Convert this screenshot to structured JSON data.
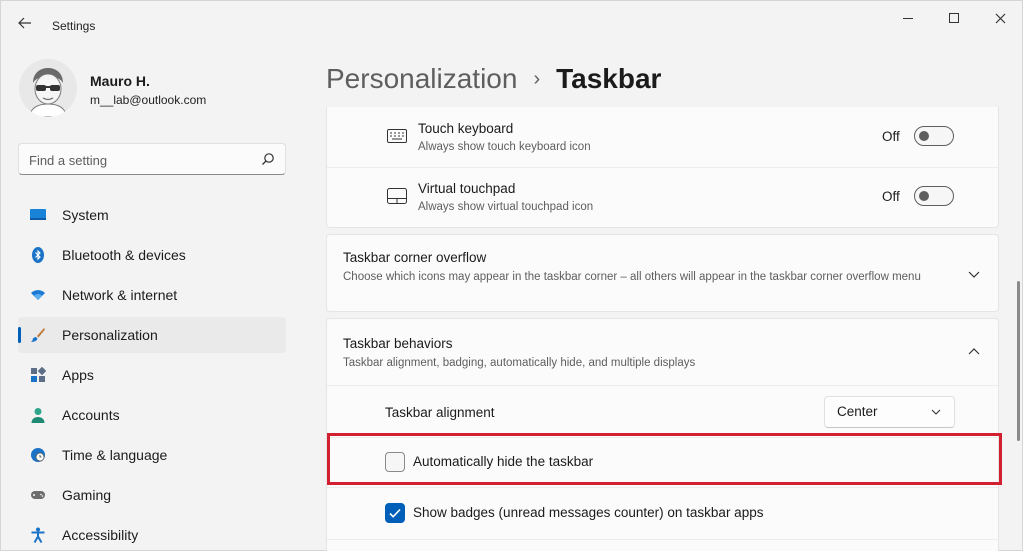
{
  "app": {
    "title": "Settings"
  },
  "profile": {
    "name": "Mauro H.",
    "email": "m__lab@outlook.com"
  },
  "search": {
    "placeholder": "Find a setting"
  },
  "sidebar": {
    "items": [
      {
        "label": "System",
        "icon": "monitor-icon",
        "selected": false
      },
      {
        "label": "Bluetooth & devices",
        "icon": "bluetooth-icon",
        "selected": false
      },
      {
        "label": "Network & internet",
        "icon": "wifi-icon",
        "selected": false
      },
      {
        "label": "Personalization",
        "icon": "paintbrush-icon",
        "selected": true
      },
      {
        "label": "Apps",
        "icon": "apps-icon",
        "selected": false
      },
      {
        "label": "Accounts",
        "icon": "person-icon",
        "selected": false
      },
      {
        "label": "Time & language",
        "icon": "globe-clock-icon",
        "selected": false
      },
      {
        "label": "Gaming",
        "icon": "gamepad-icon",
        "selected": false
      },
      {
        "label": "Accessibility",
        "icon": "accessibility-icon",
        "selected": false
      }
    ]
  },
  "breadcrumb": {
    "parent": "Personalization",
    "separator": "›",
    "current": "Taskbar"
  },
  "main": {
    "touch_keyboard": {
      "title": "Touch keyboard",
      "subtitle": "Always show touch keyboard icon",
      "state": "Off"
    },
    "virtual_touchpad": {
      "title": "Virtual touchpad",
      "subtitle": "Always show virtual touchpad icon",
      "state": "Off"
    },
    "corner_overflow": {
      "title": "Taskbar corner overflow",
      "subtitle": "Choose which icons may appear in the taskbar corner – all others will appear in the taskbar corner overflow menu"
    },
    "behaviors": {
      "title": "Taskbar behaviors",
      "subtitle": "Taskbar alignment, badging, automatically hide, and multiple displays",
      "alignment_label": "Taskbar alignment",
      "alignment_value": "Center",
      "auto_hide_label": "Automatically hide the taskbar",
      "auto_hide_checked": false,
      "badges_label": "Show badges (unread messages counter) on taskbar apps",
      "badges_checked": true
    }
  },
  "colors": {
    "accent": "#005fb8",
    "highlight": "#d32030",
    "background": "#f3f3f3",
    "card": "#fbfbfb"
  }
}
